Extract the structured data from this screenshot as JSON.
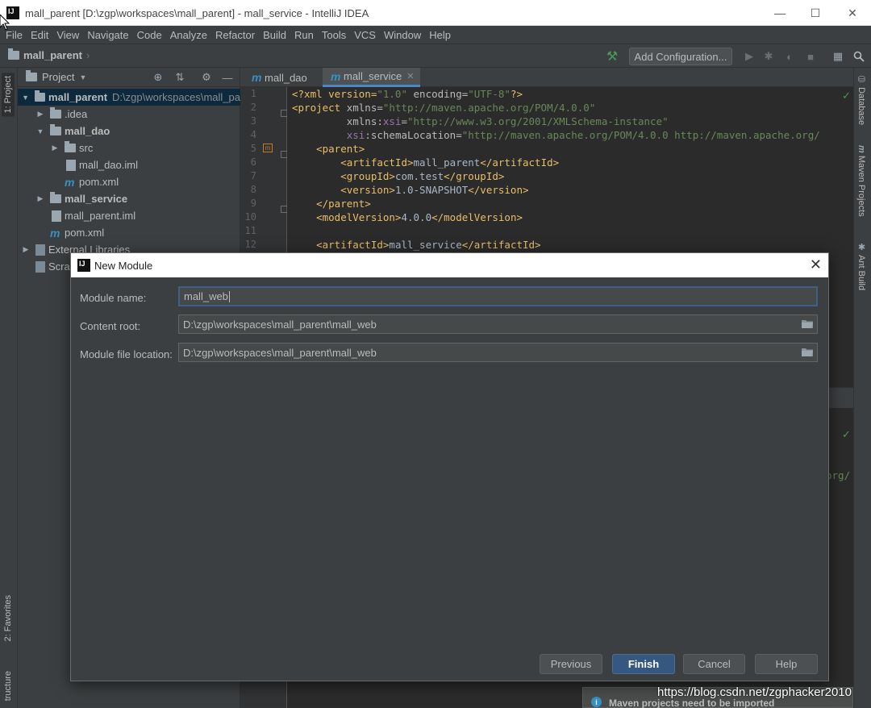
{
  "window": {
    "app_icon_text": "IJ",
    "title": "mall_parent [D:\\zgp\\workspaces\\mall_parent] - mall_service - IntelliJ IDEA",
    "minimize": "—",
    "maximize": "☐",
    "close": "✕"
  },
  "menu": [
    "File",
    "Edit",
    "View",
    "Navigate",
    "Code",
    "Analyze",
    "Refactor",
    "Build",
    "Run",
    "Tools",
    "VCS",
    "Window",
    "Help"
  ],
  "navbar": {
    "breadcrumb": "mall_parent",
    "add_configuration": "Add Configuration..."
  },
  "left_stripe": {
    "project_tab": "1: Project",
    "favorites_tab": "2: Favorites",
    "structure_tab": "tructure"
  },
  "right_stripe": {
    "database": "Database",
    "maven": "Maven Projects",
    "ant": "Ant Build"
  },
  "project_panel": {
    "title": "Project",
    "tree": [
      {
        "label": "mall_parent",
        "path": "D:\\zgp\\workspaces\\mall_pa"
      },
      {
        "label": ".idea"
      },
      {
        "label": "mall_dao"
      },
      {
        "label": "src"
      },
      {
        "label": "mall_dao.iml"
      },
      {
        "label": "pom.xml"
      },
      {
        "label": "mall_service"
      },
      {
        "label": "mall_parent.iml"
      },
      {
        "label": "pom.xml"
      },
      {
        "label": "External Libraries"
      },
      {
        "label": "Scra"
      }
    ]
  },
  "editor": {
    "tabs": [
      {
        "label": "mall_dao"
      },
      {
        "label": "mall_service"
      }
    ],
    "line_numbers": [
      "1",
      "2",
      "3",
      "4",
      "5",
      "6",
      "7",
      "8",
      "9",
      "10",
      "11",
      "12"
    ],
    "code": {
      "l1a": "<?xml version=",
      "l1b": "\"1.0\"",
      "l1c": " encoding=",
      "l1d": "\"UTF-8\"",
      "l1e": "?>",
      "l2a": "<project ",
      "l2b": "xmlns=",
      "l2c": "\"http://maven.apache.org/POM/4.0.0\"",
      "l3a": "         xmlns:",
      "l3b": "xsi",
      "l3c": "=",
      "l3d": "\"http://www.w3.org/2001/XMLSchema-instance\"",
      "l4a": "         ",
      "l4b": "xsi",
      "l4c": ":schemaLocation=",
      "l4d": "\"http://maven.apache.org/POM/4.0.0 http://maven.apache.org/",
      "l5": "    <parent>",
      "l6a": "        <artifactId>",
      "l6b": "mall_parent",
      "l6c": "</artifactId>",
      "l7a": "        <groupId>",
      "l7b": "com.test",
      "l7c": "</groupId>",
      "l8a": "        <version>",
      "l8b": "1.0-SNAPSHOT",
      "l8c": "</version>",
      "l9": "    </parent>",
      "l10a": "    <modelVersion>",
      "l10b": "4.0.0",
      "l10c": "</modelVersion>",
      "l12a": "    <artifactId>",
      "l12b": "mall_service",
      "l12c": "</artifactId>",
      "right_fragment": "org/"
    }
  },
  "dialog": {
    "title": "New Module",
    "module_name_label": "Module name:",
    "module_name_value": "mall_web",
    "content_root_label": "Content root:",
    "content_root_value": "D:\\zgp\\workspaces\\mall_parent\\mall_web",
    "module_file_label": "Module file location:",
    "module_file_value": "D:\\zgp\\workspaces\\mall_parent\\mall_web",
    "buttons": {
      "previous": "Previous",
      "finish": "Finish",
      "cancel": "Cancel",
      "help": "Help"
    }
  },
  "notification": {
    "text": "Maven projects need to be imported"
  },
  "watermark": "https://blog.csdn.net/zgphacker2010",
  "colors": {
    "accent": "#4a88c7",
    "primary_button": "#365880",
    "maven_blue": "#3592c4",
    "run_green": "#499c54"
  }
}
